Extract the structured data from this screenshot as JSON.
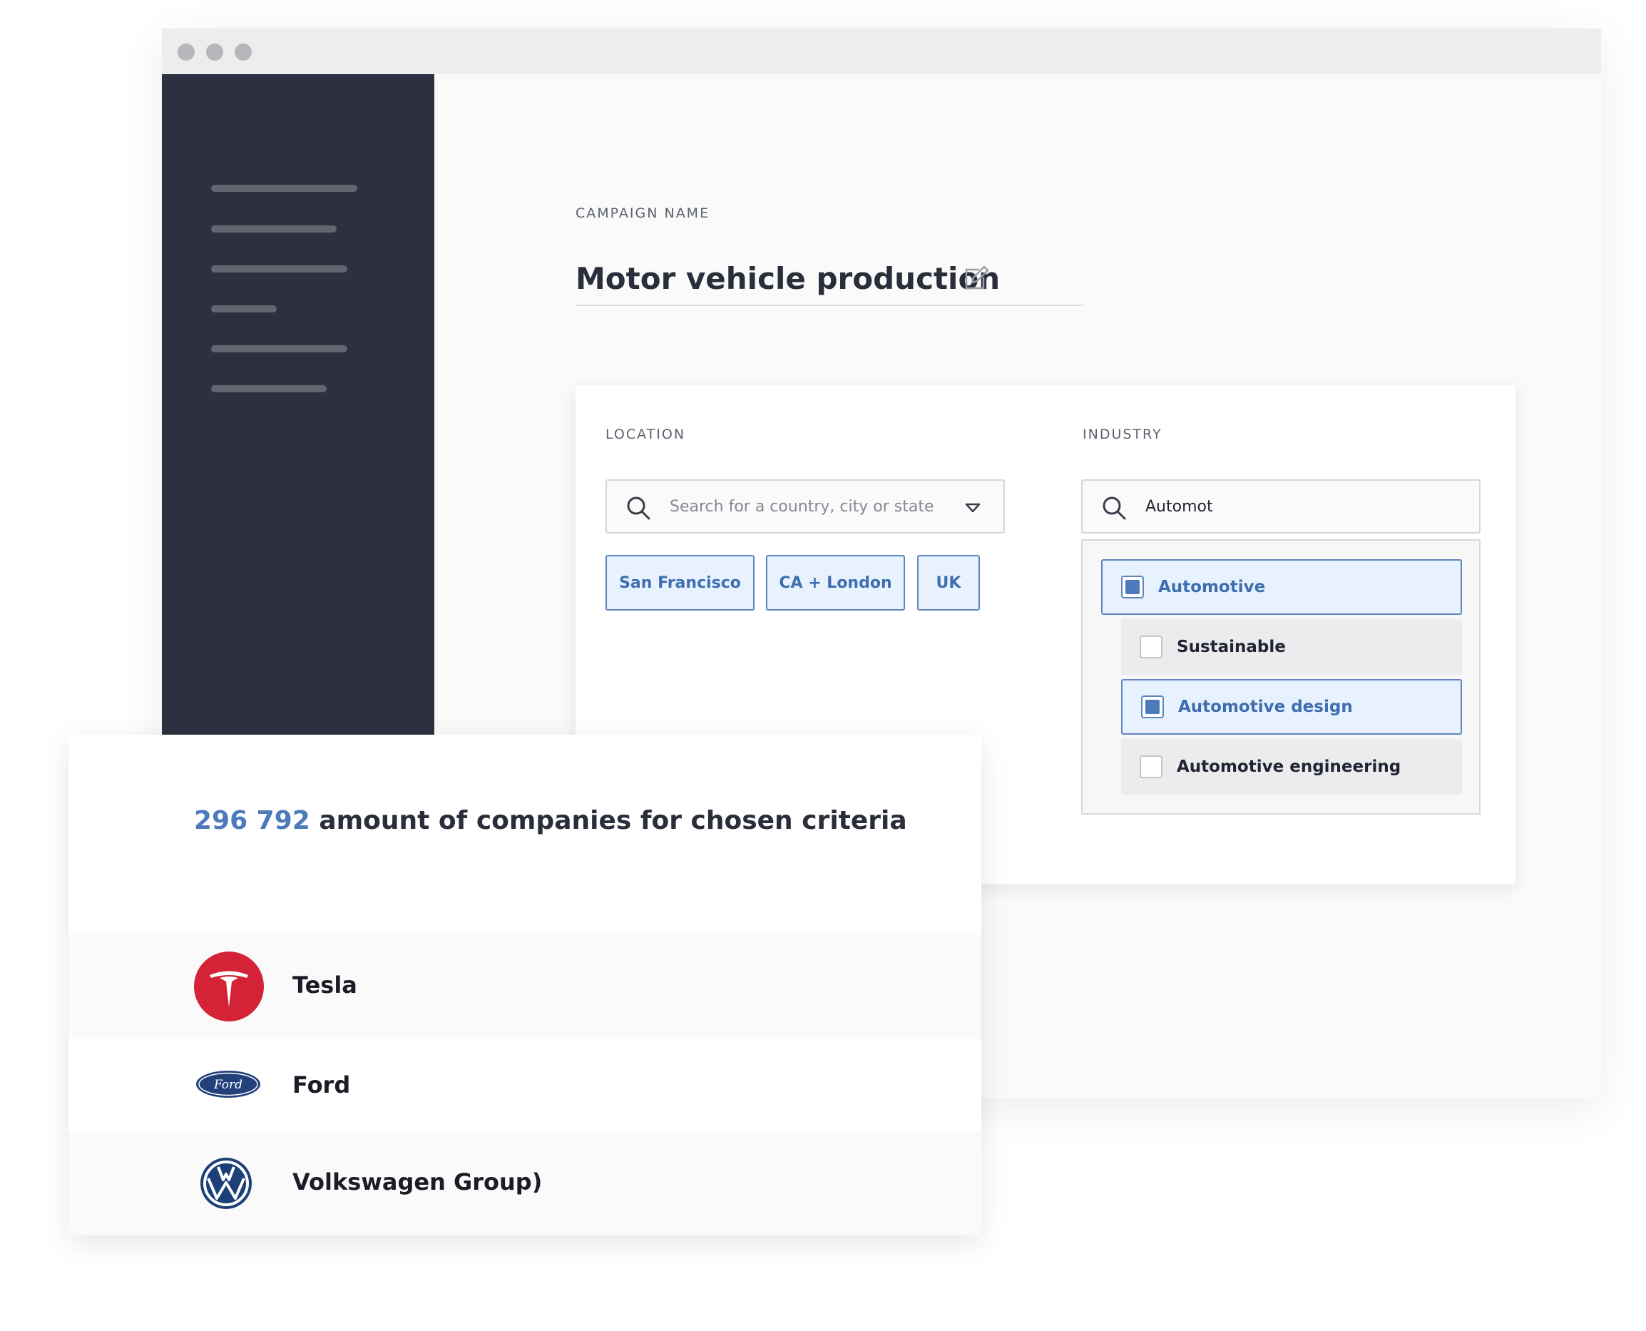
{
  "campaign": {
    "label": "CAMPAIGN NAME",
    "title": "Motor vehicle production"
  },
  "location": {
    "label": "LOCATION",
    "placeholder": "Search for a country, city or state",
    "chips": [
      "San Francisco",
      "CA + London",
      "UK"
    ]
  },
  "industry": {
    "label": "INDUSTRY",
    "query": "Automot",
    "options": [
      {
        "label": "Automotive",
        "checked": true
      },
      {
        "label": "Sustainable",
        "checked": false
      },
      {
        "label": "Automotive design",
        "checked": true
      },
      {
        "label": "Automotive engineering",
        "checked": false
      }
    ]
  },
  "results": {
    "count": "296 792",
    "text": "amount of companies for chosen criteria",
    "companies": [
      {
        "name": "Tesla",
        "logo": "tesla-logo-icon"
      },
      {
        "name": "Ford",
        "logo": "ford-logo-icon"
      },
      {
        "name": "Volkswagen Group)",
        "logo": "volkswagen-logo-icon"
      }
    ],
    "logo_text": {
      "ford": "Ford"
    }
  },
  "colors": {
    "accent": "#4c7abb",
    "sidebar": "#2d3040",
    "chip_bg": "#e8f2fe",
    "tesla_red": "#d42337",
    "ford_blue": "#22407a",
    "vw_blue": "#1c3f78"
  }
}
